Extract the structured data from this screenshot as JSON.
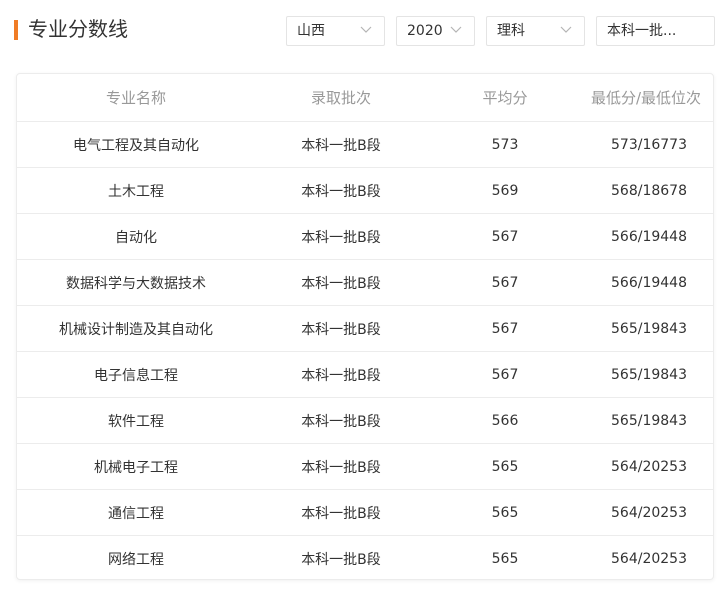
{
  "page_title": "专业分数线",
  "filters": {
    "province": "山西",
    "year": "2020",
    "subject": "理科",
    "batch": "本科一批..."
  },
  "table": {
    "headers": [
      "专业名称",
      "录取批次",
      "平均分",
      "最低分/最低位次"
    ],
    "rows": [
      {
        "major": "电气工程及其自动化",
        "batch": "本科一批B段",
        "avg": "573",
        "min": "573/16773"
      },
      {
        "major": "土木工程",
        "batch": "本科一批B段",
        "avg": "569",
        "min": "568/18678"
      },
      {
        "major": "自动化",
        "batch": "本科一批B段",
        "avg": "567",
        "min": "566/19448"
      },
      {
        "major": "数据科学与大数据技术",
        "batch": "本科一批B段",
        "avg": "567",
        "min": "566/19448"
      },
      {
        "major": "机械设计制造及其自动化",
        "batch": "本科一批B段",
        "avg": "567",
        "min": "565/19843"
      },
      {
        "major": "电子信息工程",
        "batch": "本科一批B段",
        "avg": "567",
        "min": "565/19843"
      },
      {
        "major": "软件工程",
        "batch": "本科一批B段",
        "avg": "566",
        "min": "565/19843"
      },
      {
        "major": "机械电子工程",
        "batch": "本科一批B段",
        "avg": "565",
        "min": "564/20253"
      },
      {
        "major": "通信工程",
        "batch": "本科一批B段",
        "avg": "565",
        "min": "564/20253"
      },
      {
        "major": "网络工程",
        "batch": "本科一批B段",
        "avg": "565",
        "min": "564/20253"
      }
    ]
  },
  "colors": {
    "accent": "#f07c26",
    "header_text": "#999999",
    "body_text": "#333333",
    "border": "#ececec"
  },
  "icons": {
    "dropdown": "chevron-down-icon"
  }
}
